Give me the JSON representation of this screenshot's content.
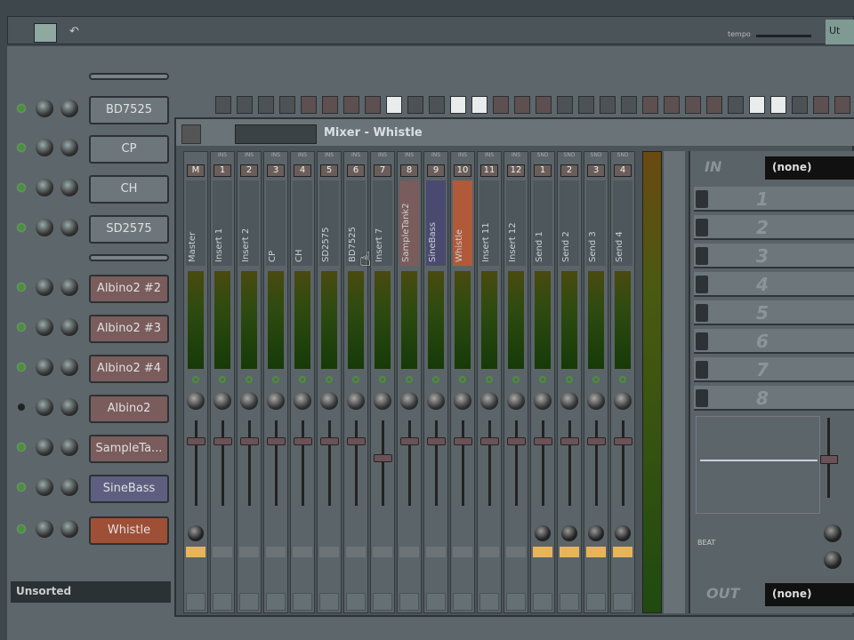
{
  "toolbar": {
    "tempo_label": "tempo",
    "right_button": "Ut"
  },
  "channels": [
    {
      "name": "BD7525",
      "color": "#6d777b"
    },
    {
      "name": "CP",
      "color": "#6d777b"
    },
    {
      "name": "CH",
      "color": "#6d777b"
    },
    {
      "name": "SD2575",
      "color": "#6d777b"
    },
    {
      "name": "Albino2 #2",
      "color": "#7a5c5c"
    },
    {
      "name": "Albino2 #3",
      "color": "#7a5c5c"
    },
    {
      "name": "Albino2 #4",
      "color": "#7a5c5c"
    },
    {
      "name": "Albino2",
      "color": "#7a5c5c"
    },
    {
      "name": "SampleTa...",
      "color": "#7a5c5c"
    },
    {
      "name": "SineBass",
      "color": "#5e5f80"
    },
    {
      "name": "Whistle",
      "color": "#9e4f36"
    }
  ],
  "unsorted": "Unsorted",
  "mixer": {
    "title": "Mixer - Whistle",
    "strips": [
      {
        "num": "M",
        "name": "Master",
        "tag": "",
        "route": "on",
        "sendknob": true,
        "fader": 0.8
      },
      {
        "num": "1",
        "name": "Insert 1",
        "tag": "INS",
        "fader": 0.8
      },
      {
        "num": "2",
        "name": "Insert 2",
        "tag": "INS",
        "fader": 0.8
      },
      {
        "num": "3",
        "name": "CP",
        "tag": "INS",
        "fader": 0.8
      },
      {
        "num": "4",
        "name": "CH",
        "tag": "INS",
        "fader": 0.8
      },
      {
        "num": "5",
        "name": "SD2575",
        "tag": "INS",
        "fader": 0.8
      },
      {
        "num": "6",
        "name": "BD7525",
        "tag": "INS",
        "fader": 0.8
      },
      {
        "num": "7",
        "name": "Insert 7",
        "tag": "INS",
        "fader": 0.6
      },
      {
        "num": "8",
        "name": "SampleTank2",
        "tag": "INS",
        "fader": 0.8,
        "color": "#7a5c5c"
      },
      {
        "num": "9",
        "name": "SineBass",
        "tag": "INS",
        "fader": 0.8,
        "color": "#4a4a70"
      },
      {
        "num": "10",
        "name": "Whistle",
        "tag": "INS",
        "fader": 0.8,
        "color": "#b05a3a"
      },
      {
        "num": "11",
        "name": "Insert 11",
        "tag": "INS",
        "fader": 0.8
      },
      {
        "num": "12",
        "name": "Insert 12",
        "tag": "INS",
        "fader": 0.8
      },
      {
        "num": "1",
        "name": "Send 1",
        "tag": "SND",
        "route": "on",
        "sendknob": true,
        "fader": 0.8
      },
      {
        "num": "2",
        "name": "Send 2",
        "tag": "SND",
        "route": "on",
        "sendknob": true,
        "fader": 0.8
      },
      {
        "num": "3",
        "name": "Send 3",
        "tag": "SND",
        "route": "on",
        "sendknob": true,
        "fader": 0.8
      },
      {
        "num": "4",
        "name": "Send 4",
        "tag": "SND",
        "route": "on",
        "sendknob": true,
        "fader": 0.8
      }
    ],
    "fx": {
      "in_label": "IN",
      "in_value": "(none)",
      "slots": [
        "1",
        "2",
        "3",
        "4",
        "5",
        "6",
        "7",
        "8"
      ],
      "beat_label": "BEAT",
      "out_label": "OUT",
      "out_value": "(none)"
    }
  }
}
